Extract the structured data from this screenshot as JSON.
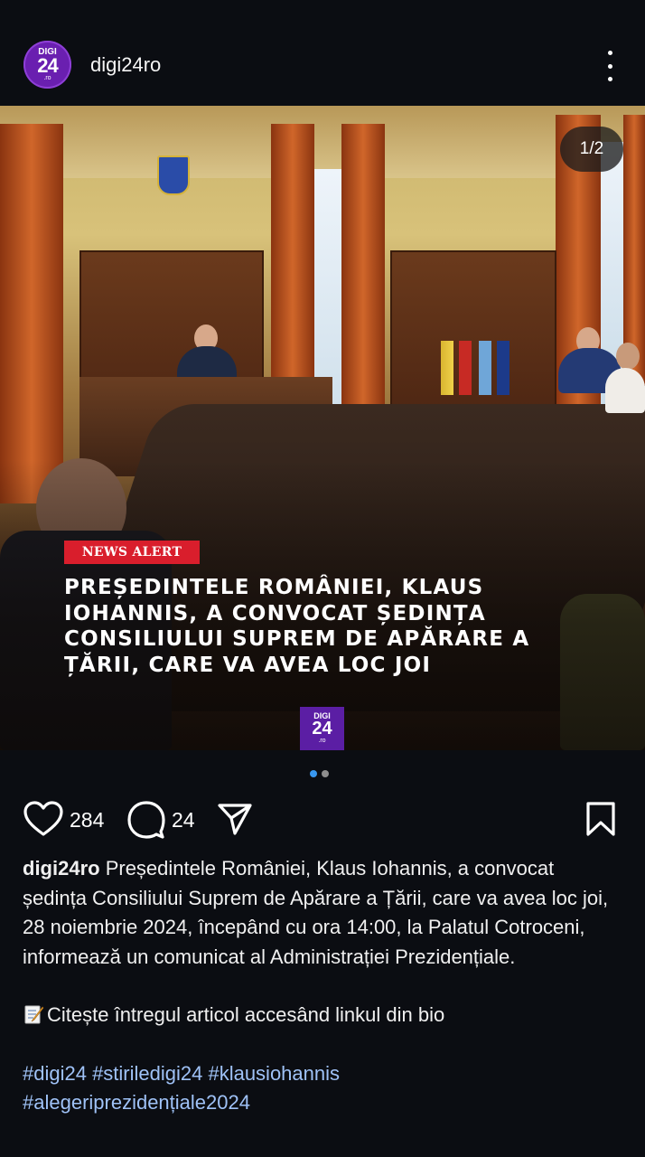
{
  "header": {
    "avatar": {
      "line1": "DIGI",
      "line2": "24",
      "line3": ".ro"
    },
    "username": "digi24ro",
    "more_icon": "vertical-ellipsis-icon"
  },
  "post": {
    "counter": "1/2",
    "badge": "NEWS ALERT",
    "headline": "PREȘEDINTELE ROMÂNIEI, KLAUS IOHANNIS, A CONVOCAT ȘEDINȚA CONSILIULUI SUPREM DE APĂRARE A ȚĂRII, CARE VA AVEA LOC JOI",
    "watermark": {
      "line1": "DIGI",
      "line2": "24",
      "line3": ".ro"
    },
    "carousel_active_color": "#3897f0",
    "carousel_inactive_color": "#8e8e8e"
  },
  "actions": {
    "likes": "284",
    "comments": "24",
    "like_icon": "heart-icon",
    "comment_icon": "speech-bubble-icon",
    "share_icon": "paper-plane-icon",
    "save_icon": "bookmark-icon"
  },
  "caption": {
    "username": "digi24ro",
    "text": " Președintele României, Klaus Iohannis, a convocat ședința Consiliului Suprem de Apărare a Țării, care va avea loc joi, 28 noiembrie 2024, începând cu ora 14:00, la Palatul Cotroceni, informează un comunicat al Administrației Prezidențiale.",
    "cta": "Citește întregul articol accesând linkul din bio",
    "cta_icon": "memo-icon",
    "hashtags_line1": "#digi24 #stiriledigi24 #klausiohannis",
    "hashtags_line2": "#alegeriprezidențiale2024",
    "hashtag_color": "#9fc2f7"
  }
}
